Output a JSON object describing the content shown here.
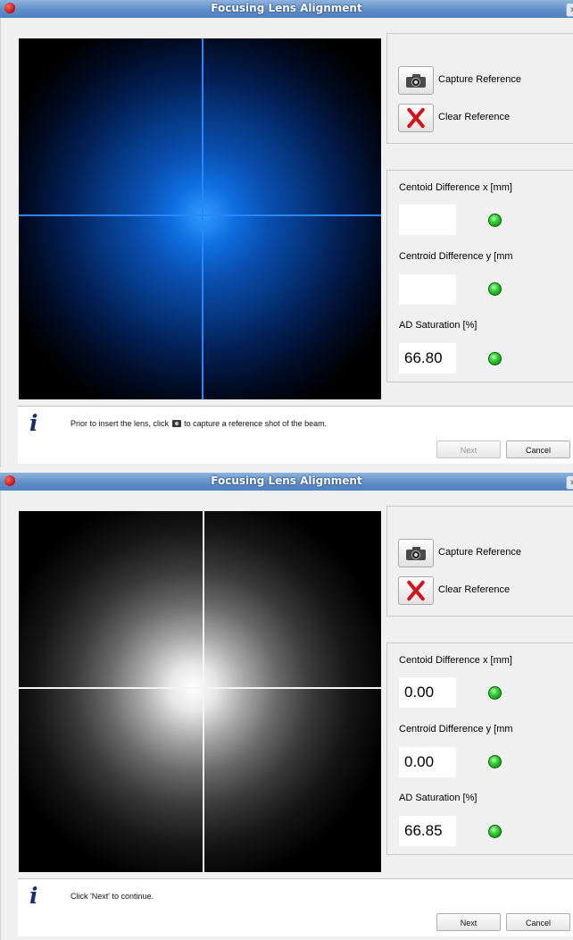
{
  "colors": {
    "title_bar": "#5f8fc7",
    "led_ok": "#3dd43d",
    "crosshair_1": "#2a86ff",
    "crosshair_2": "#f4f4f4"
  },
  "windows": [
    {
      "title": "Focusing Lens Alignment",
      "beam_color": "blue",
      "reference_panel": {
        "capture_label": "Capture Reference",
        "clear_label": "Clear Reference"
      },
      "measurements": [
        {
          "label": "Centoid Difference x [mm]",
          "value": "",
          "status": "ok"
        },
        {
          "label": "Centroid Difference y [mm",
          "value": "",
          "status": "ok"
        },
        {
          "label": "AD Saturation [%]",
          "value": "66.80",
          "status": "ok"
        }
      ],
      "info": {
        "icon": "info-icon",
        "before": "Prior to insert the lens, click",
        "after": "to capture a reference shot of the beam."
      },
      "buttons": {
        "next": "Next",
        "next_enabled": false,
        "cancel": "Cancel"
      }
    },
    {
      "title": "Focusing Lens Alignment",
      "beam_color": "white",
      "reference_panel": {
        "capture_label": "Capture Reference",
        "clear_label": "Clear Reference"
      },
      "measurements": [
        {
          "label": "Centoid Difference x [mm]",
          "value": "0.00",
          "status": "ok"
        },
        {
          "label": "Centroid Difference y [mm",
          "value": "0.00",
          "status": "ok"
        },
        {
          "label": "AD Saturation [%]",
          "value": "66.85",
          "status": "ok"
        }
      ],
      "info": {
        "icon": "info-icon",
        "before": "Click 'Next' to continue.",
        "after": ""
      },
      "buttons": {
        "next": "Next",
        "next_enabled": true,
        "cancel": "Cancel"
      }
    }
  ]
}
